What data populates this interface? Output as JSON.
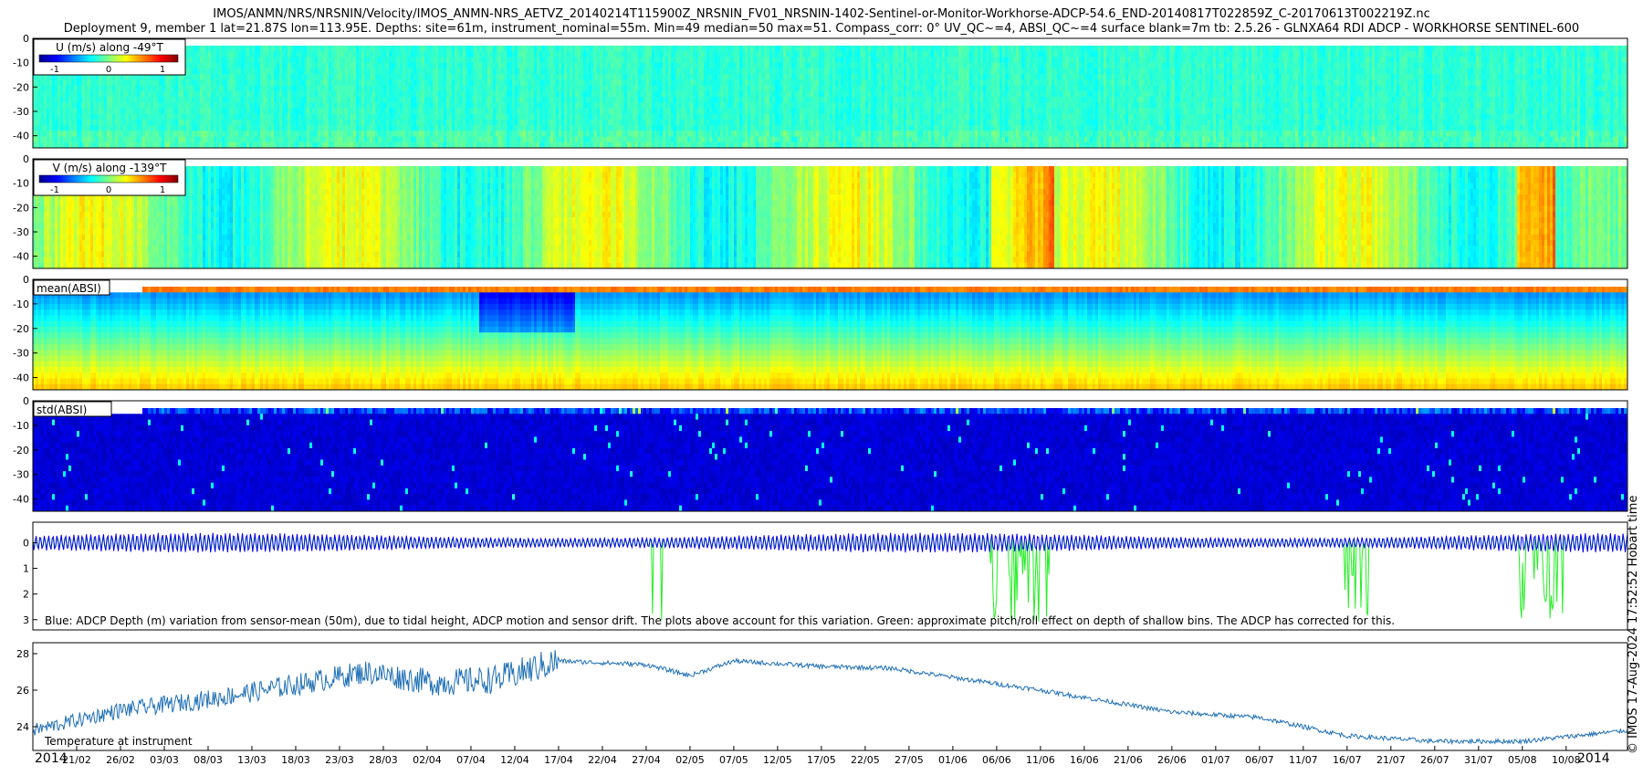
{
  "header": {
    "line1": "IMOS/ANMN/NRS/NRSNIN/Velocity/IMOS_ANMN-NRS_AETVZ_20140214T115900Z_NRSNIN_FV01_NRSNIN-1402-Sentinel-or-Monitor-Workhorse-ADCP-54.6_END-20140817T022859Z_C-20170613T002219Z.nc",
    "line2": "Deployment 9, member 1 lat=21.87S lon=113.95E. Depths: site=61m, instrument_nominal=55m. Min=49 median=50 max=51. Compass_corr: 0° UV_QC~=4, ABSI_QC~=4 surface blank=7m tb: 2.5.26 - GLNXA64 RDI ADCP - WORKHORSE SENTINEL-600"
  },
  "side_note": "© IMOS 17-Aug-2024 17:52:52 Hobart time",
  "colors": {
    "blue_series": "#0000ee",
    "green_series": "#22ee22",
    "temp_series": "#1f6fb5",
    "jet_low": "#00008f",
    "jet_high": "#800000"
  },
  "x_axis": {
    "year_label_start": "2014",
    "year_label_end": "2014",
    "ticks": [
      "21/02",
      "26/02",
      "03/03",
      "08/03",
      "13/03",
      "18/03",
      "23/03",
      "28/03",
      "02/04",
      "07/04",
      "12/04",
      "17/04",
      "22/04",
      "27/04",
      "02/05",
      "07/05",
      "12/05",
      "17/05",
      "22/05",
      "27/05",
      "01/06",
      "06/06",
      "11/06",
      "16/06",
      "21/06",
      "26/06",
      "01/07",
      "06/07",
      "11/07",
      "16/07",
      "21/07",
      "26/07",
      "31/07",
      "05/08",
      "10/08"
    ]
  },
  "chart_data": [
    {
      "type": "heatmap",
      "panel": "u",
      "legend_title": "U (m/s) along -49°T",
      "colorbar_ticks": [
        "-1",
        "0",
        "1"
      ],
      "clim": [
        -1,
        1
      ],
      "y_ticks": [
        "0",
        "-10",
        "-20",
        "-30",
        "-40"
      ],
      "ylim": [
        0,
        -45
      ],
      "xlim": [
        "2014-02-16",
        "2014-08-17"
      ]
    },
    {
      "type": "heatmap",
      "panel": "v",
      "legend_title": "V (m/s) along -139°T",
      "colorbar_ticks": [
        "-1",
        "0",
        "1"
      ],
      "clim": [
        -1,
        1
      ],
      "y_ticks": [
        "0",
        "-10",
        "-20",
        "-30",
        "-40"
      ],
      "ylim": [
        0,
        -45
      ],
      "xlim": [
        "2014-02-16",
        "2014-08-17"
      ]
    },
    {
      "type": "heatmap",
      "panel": "mean_absi",
      "legend_title": "mean(ABSI)",
      "y_ticks": [
        "0",
        "-10",
        "-20",
        "-30",
        "-40"
      ],
      "ylim": [
        0,
        -45
      ],
      "xlim": [
        "2014-02-16",
        "2014-08-17"
      ]
    },
    {
      "type": "heatmap",
      "panel": "std_absi",
      "legend_title": "std(ABSI)",
      "y_ticks": [
        "0",
        "-10",
        "-20",
        "-30",
        "-40"
      ],
      "ylim": [
        0,
        -45
      ],
      "xlim": [
        "2014-02-16",
        "2014-08-17"
      ]
    },
    {
      "type": "line",
      "panel": "depth",
      "y_ticks": [
        "0",
        "1",
        "2",
        "3"
      ],
      "ylim": [
        -0.8,
        3.4
      ],
      "annotation": "Blue: ADCP Depth (m) variation from sensor-mean (50m), due to tidal height, ADCP motion and sensor drift. The plots above account for this variation. Green: approximate pitch/roll effect on depth of shallow bins. The ADCP has corrected for this.",
      "xlim": [
        "2014-02-16",
        "2014-08-17"
      ]
    },
    {
      "type": "line",
      "panel": "temperature",
      "annotation": "Temperature at instrument",
      "y_ticks": [
        "24",
        "26",
        "28"
      ],
      "ylim": [
        22.7,
        28.6
      ],
      "x": [
        "2014-02-16",
        "2014-02-26",
        "2014-03-08",
        "2014-03-18",
        "2014-03-26",
        "2014-04-03",
        "2014-04-10",
        "2014-04-17",
        "2014-04-27",
        "2014-05-02",
        "2014-05-07",
        "2014-05-17",
        "2014-05-25",
        "2014-06-01",
        "2014-06-11",
        "2014-06-21",
        "2014-06-26",
        "2014-07-06",
        "2014-07-16",
        "2014-07-26",
        "2014-08-05",
        "2014-08-17"
      ],
      "y": [
        23.8,
        24.9,
        25.5,
        26.3,
        27.0,
        26.4,
        26.6,
        27.6,
        27.4,
        26.8,
        27.6,
        27.3,
        27.2,
        26.7,
        26.0,
        25.2,
        24.8,
        24.5,
        23.5,
        23.2,
        23.2,
        23.8
      ],
      "xlim": [
        "2014-02-16",
        "2014-08-17"
      ]
    }
  ]
}
